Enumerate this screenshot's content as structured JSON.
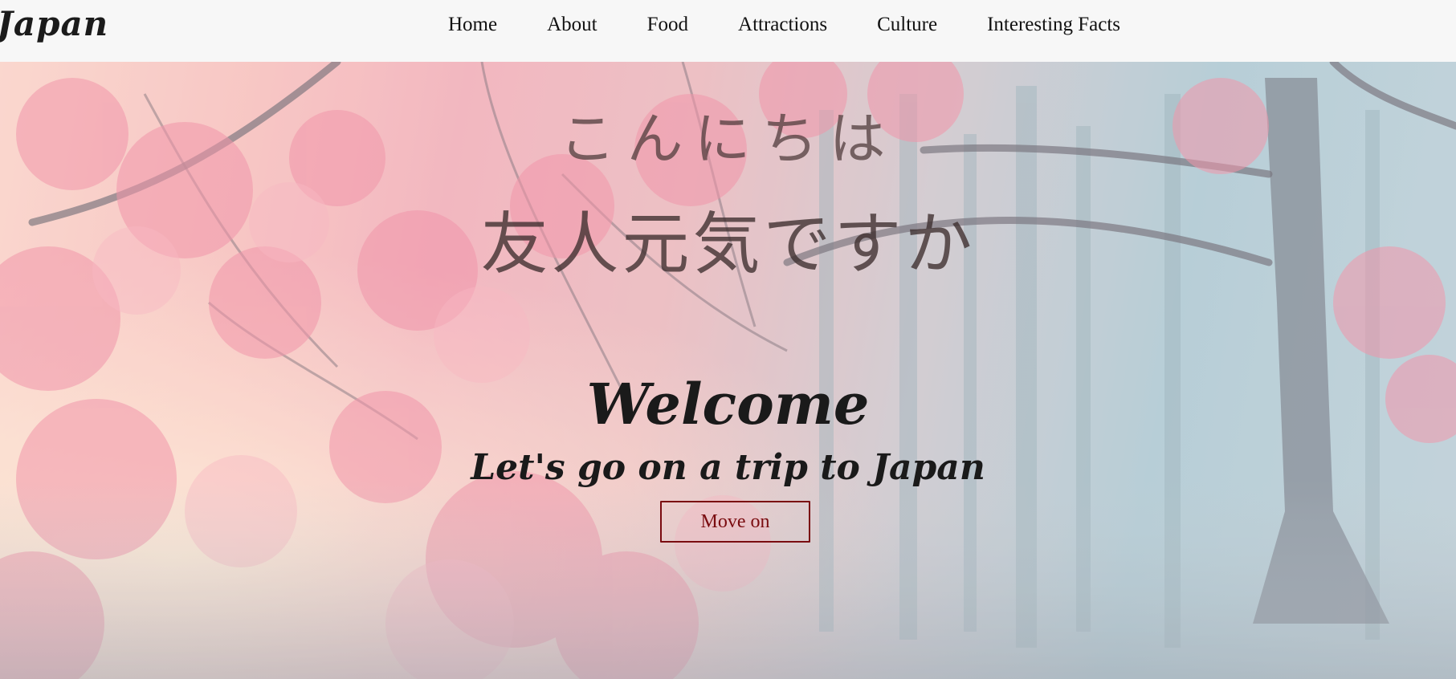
{
  "header": {
    "brand": "Japan",
    "nav": [
      {
        "label": "Home"
      },
      {
        "label": "About"
      },
      {
        "label": "Food"
      },
      {
        "label": "Attractions"
      },
      {
        "label": "Culture"
      },
      {
        "label": "Interesting Facts"
      }
    ]
  },
  "hero": {
    "greeting_line_1": "こんにちは",
    "greeting_line_2": "友人元気ですか",
    "title": "Welcome",
    "subtitle": "Let's go on a trip to Japan",
    "cta_label": "Move on",
    "background_description_colors": {
      "blossom": "#f08aa0",
      "fog": "#a9c8d2",
      "cta": "#7a0c10"
    }
  }
}
